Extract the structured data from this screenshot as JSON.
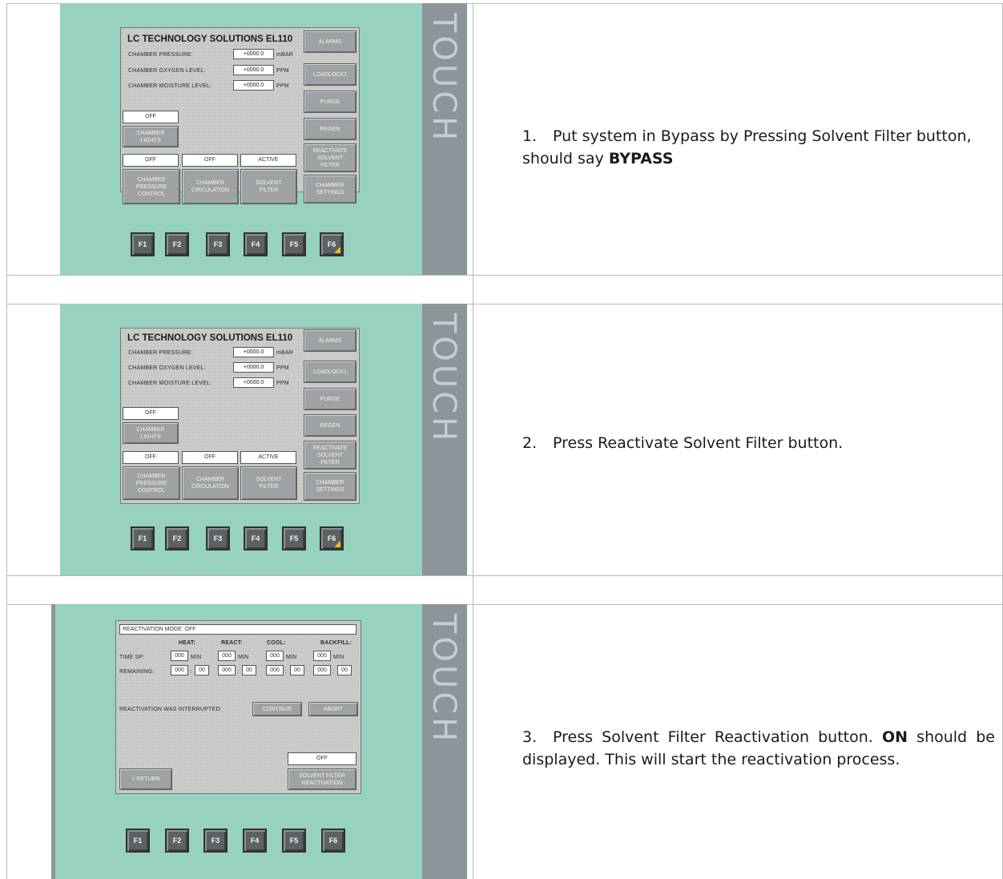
{
  "steps": [
    {
      "number": "1.",
      "text_parts": [
        "Put system in Bypass by Pressing Solvent Filter button, should say ",
        "BYPASS",
        ""
      ]
    },
    {
      "number": "2.",
      "text_parts": [
        "Press Reactivate Solvent Filter button.",
        "",
        ""
      ]
    },
    {
      "number": "3.",
      "text_parts": [
        "Press Solvent Filter Reactivation button. ",
        "ON",
        " should be displayed. This will start the reactivation process."
      ]
    }
  ],
  "panel_main": {
    "touch_label": "TOUCH",
    "title": "LC TECHNOLOGY SOLUTIONS EL110",
    "readings": [
      {
        "label": "CHAMBER PRESSURE:",
        "value": "+0000.0",
        "unit": "mBAR"
      },
      {
        "label": "CHAMBER OXYGEN LEVEL:",
        "value": "+0000.0",
        "unit": "PPM"
      },
      {
        "label": "CHAMBER MOISTURE LEVEL:",
        "value": "+0000.0",
        "unit": "PPM"
      }
    ],
    "lights_status": "OFF",
    "lights_button": "CHAMBER\nLIGHTS",
    "statuses": [
      "OFF",
      "OFF",
      "ACTIVE"
    ],
    "bottom_buttons": [
      "CHAMBER\nPRESSURE\nCONTROL",
      "CHAMBER\nCIRCULATION",
      "SOLVENT\nFILTER"
    ],
    "side_buttons": [
      "ALARMS",
      "LOADLOCK1",
      "PURGE",
      "REGEN",
      "REACTIVATE\nSOLVENT\nFILTER",
      "CHAMBER\nSETTINGS"
    ],
    "fkeys": [
      "F1",
      "F2",
      "F3",
      "F4",
      "F5",
      "F6"
    ]
  },
  "panel_reactivation": {
    "touch_label": "TOUCH",
    "mode_label": "REACTIVATION MODE: OFF",
    "phases": [
      "HEAT:",
      "REACT:",
      "COOL:",
      "BACKFILL:"
    ],
    "time_sp_label": "TIME SP:",
    "remaining_label": "REMAINING:",
    "time_sp_values": [
      "000",
      "000",
      "000",
      "000"
    ],
    "min_unit": "MIN",
    "remaining_values": [
      [
        "000",
        "00"
      ],
      [
        "000",
        "00"
      ],
      [
        "000",
        "00"
      ],
      [
        "000",
        "00"
      ]
    ],
    "separator": ":",
    "interrupted_label": "REACTIVATION WAS INTERRUPTED:",
    "continue_button": "CONTINUE",
    "abort_button": "ABORT",
    "reactivation_status": "OFF",
    "reactivation_button": "SOLVENT FILTER\nREACTIVATION",
    "return_button": "< RETURN",
    "fkeys": [
      "F1",
      "F2",
      "F3",
      "F4",
      "F5",
      "F6"
    ]
  }
}
